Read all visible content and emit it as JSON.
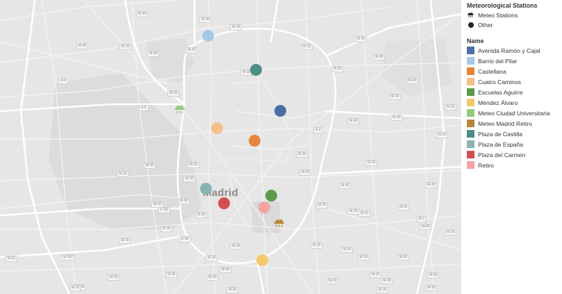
{
  "map": {
    "city_label": "Madrid",
    "road_labels": [
      "M-40",
      "M-30",
      "M-40",
      "M-30",
      "M-30",
      "M-40",
      "A-6",
      "M-30",
      "A-6",
      "M-30",
      "M-30",
      "M-30",
      "M-30",
      "M-23",
      "M-30",
      "M-30",
      "A-2",
      "M-30",
      "M-30",
      "M-30",
      "M-30",
      "M-30",
      "M-30",
      "M-30",
      "M-30",
      "M-30",
      "M-30",
      "M-30",
      "M-30",
      "M-40",
      "E-90",
      "M-30",
      "M-30",
      "M-30",
      "M-30",
      "M-30",
      "M-21",
      "B-3",
      "M-40",
      "M-30",
      "M-30",
      "M-30",
      "M-30",
      "M-30",
      "M-30",
      "M-30",
      "M-30",
      "M-30",
      "M-30",
      "M-30",
      "M-30",
      "M-01",
      "M-502",
      "M-30",
      "M-40",
      "M-30",
      "M-30",
      "E-90",
      "M-30",
      "M-30",
      "M-30",
      "M-30",
      "M-30",
      "M-30",
      "M-30",
      "M-30"
    ],
    "stations": [
      {
        "name": "Barrio del Pilar",
        "color": "#a6c8e8"
      },
      {
        "name": "Plaza de Castilla",
        "color": "#4d8c88"
      },
      {
        "name": "Avenida Ramón y Cajal",
        "color": "#4a6fa5"
      },
      {
        "name": "Cuatro Caminos",
        "color": "#f5bf8b"
      },
      {
        "name": "Castellana",
        "color": "#e8853a"
      },
      {
        "name": "Plaza de España",
        "color": "#86b4b2"
      },
      {
        "name": "Escuelas Aguirre",
        "color": "#5c9a4b"
      },
      {
        "name": "Plaza del Carmen",
        "color": "#d14f4f"
      },
      {
        "name": "Retiro",
        "color": "#f5a3a3"
      },
      {
        "name": "Méndez Álvaro",
        "color": "#f2c86a"
      }
    ],
    "meteo_stations": [
      {
        "name": "Meteo Ciudad Universitaria",
        "color": "#97c97f",
        "icon": "rain-cloud-icon"
      },
      {
        "name": "Meteo Madrid Retiro",
        "color": "#b5893a",
        "icon": "rain-cloud-icon"
      }
    ]
  },
  "legend": {
    "group1_title": "Meteorological Stations",
    "group1_items": [
      {
        "label": "Meteo Stations",
        "icon": "rain-cloud-icon"
      },
      {
        "label": "Other",
        "icon": "filled-circle-icon"
      }
    ],
    "group2_title": "Name",
    "group2_items": [
      {
        "label": "Avenida Ramón y Cajal",
        "color": "#4a6fa5"
      },
      {
        "label": "Barrio del Pilar",
        "color": "#a6c8e8"
      },
      {
        "label": "Castellana",
        "color": "#e8853a"
      },
      {
        "label": "Cuatro Caminos",
        "color": "#f5bf8b"
      },
      {
        "label": "Escuelas Aguirre",
        "color": "#5c9a4b"
      },
      {
        "label": "Méndez Álvaro",
        "color": "#f2c86a"
      },
      {
        "label": "Meteo Ciudad Universitaria",
        "color": "#97c97f"
      },
      {
        "label": "Meteo Madrid Retiro",
        "color": "#b5893a"
      },
      {
        "label": "Plaza de Castilla",
        "color": "#4d8c88"
      },
      {
        "label": "Plaza de España",
        "color": "#86b4b2"
      },
      {
        "label": "Plaza del Carmen",
        "color": "#d14f4f"
      },
      {
        "label": "Retiro",
        "color": "#f5a3a3"
      }
    ]
  }
}
